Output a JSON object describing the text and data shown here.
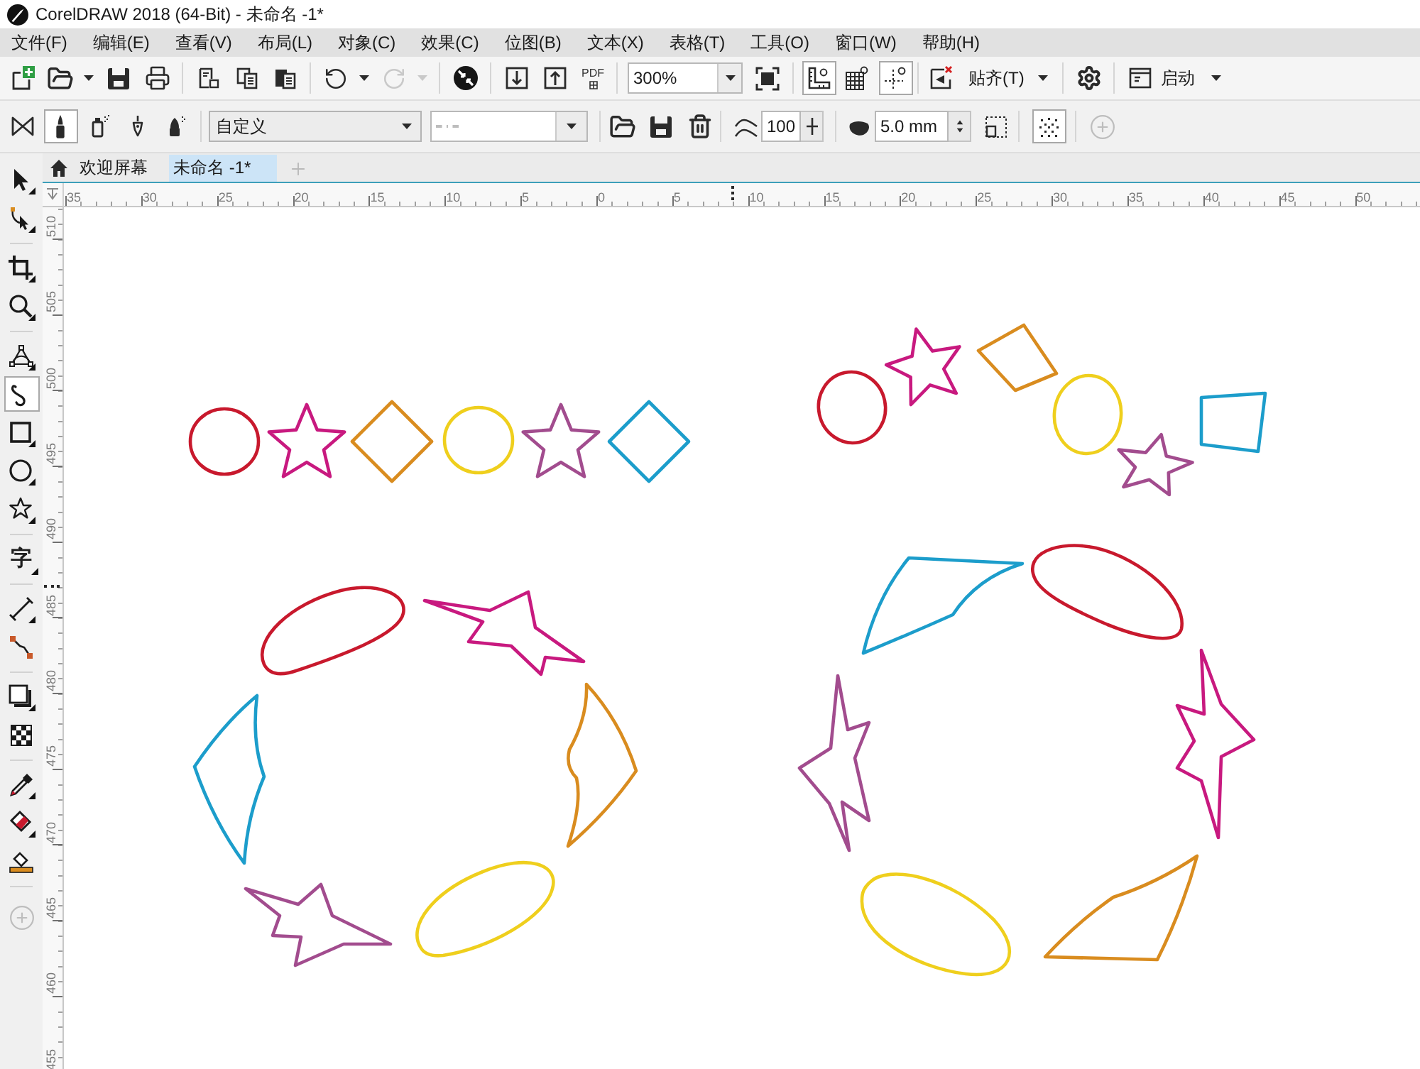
{
  "window": {
    "title": "CorelDRAW 2018 (64-Bit) - 未命名 -1*"
  },
  "menu": [
    "文件(F)",
    "编辑(E)",
    "查看(V)",
    "布局(L)",
    "对象(C)",
    "效果(C)",
    "位图(B)",
    "文本(X)",
    "表格(T)",
    "工具(O)",
    "窗口(W)",
    "帮助(H)"
  ],
  "standard_toolbar": {
    "redo": {
      "disabled": true
    },
    "pdf_label": "PDF",
    "zoom": "300%",
    "view_toggles": [
      {
        "on": true
      },
      {
        "on": false
      },
      {
        "on": true
      }
    ],
    "snap_label": "贴齐(T)",
    "launcher_label": "启动"
  },
  "property_bar": {
    "modes": [
      {
        "selected": false
      },
      {
        "selected": true
      },
      {
        "selected": false
      },
      {
        "selected": false
      },
      {
        "selected": false
      }
    ],
    "preset": "自定义",
    "smoothing": "100",
    "width": "5.0 mm",
    "options_toggle": {
      "on": true
    },
    "add_button": {
      "disabled": true
    }
  },
  "toolbox": {
    "groups": [
      [
        {
          "kind": "tool",
          "selected": false
        },
        {
          "kind": "tool",
          "selected": false
        }
      ],
      [
        {
          "kind": "tool",
          "selected": false
        },
        {
          "kind": "tool",
          "selected": false
        }
      ],
      [
        {
          "kind": "tool",
          "selected": false
        },
        {
          "kind": "tool",
          "selected": true
        },
        {
          "kind": "tool",
          "selected": false
        },
        {
          "kind": "tool",
          "selected": false
        },
        {
          "kind": "tool",
          "selected": false
        }
      ],
      [
        {
          "kind": "glyph",
          "label": "字",
          "selected": false
        }
      ],
      [
        {
          "kind": "tool",
          "selected": false
        },
        {
          "kind": "tool",
          "selected": false
        }
      ],
      [
        {
          "kind": "tool",
          "selected": false
        },
        {
          "kind": "tool",
          "selected": false
        }
      ],
      [
        {
          "kind": "tool",
          "selected": false
        },
        {
          "kind": "tool",
          "selected": false
        },
        {
          "kind": "tool",
          "selected": false
        }
      ],
      [
        {
          "kind": "add"
        }
      ]
    ]
  },
  "tabs": [
    {
      "kind": "home",
      "label": "欢迎屏幕",
      "selected": false
    },
    {
      "kind": "document",
      "label": "未命名 -1*",
      "selected": true
    }
  ],
  "horizontal_ruler": [
    "35",
    "30",
    "25",
    "20",
    "15",
    "10",
    "5",
    "0",
    "5",
    "10",
    "15",
    "20",
    "25",
    "30",
    "35",
    "40",
    "45",
    "50"
  ],
  "vertical_ruler": [
    "510",
    "505",
    "500",
    "495",
    "490",
    "485",
    "480",
    "475",
    "470",
    "465",
    "460",
    "455"
  ],
  "canvas": {
    "groups": [
      {
        "shapes": [
          {
            "kind": "ellipse",
            "color": "#c8192d"
          },
          {
            "kind": "star",
            "color": "#c8197f"
          },
          {
            "kind": "diamond",
            "color": "#d98c1f"
          },
          {
            "kind": "ellipse",
            "color": "#efcf1d"
          },
          {
            "kind": "star",
            "color": "#a24c8e"
          },
          {
            "kind": "diamond",
            "color": "#1c9dcb"
          }
        ]
      },
      {
        "shapes": [
          {
            "kind": "ellipse",
            "color": "#c8192d"
          },
          {
            "kind": "star",
            "color": "#c8197f"
          },
          {
            "kind": "diamond",
            "color": "#d98c1f"
          },
          {
            "kind": "ellipse",
            "color": "#efcf1d"
          },
          {
            "kind": "star",
            "color": "#a24c8e"
          },
          {
            "kind": "diamond",
            "color": "#1c9dcb"
          }
        ]
      },
      {
        "shapes": [
          {
            "kind": "ellipse",
            "color": "#c8192d"
          },
          {
            "kind": "star",
            "color": "#c8197f"
          },
          {
            "kind": "diamond",
            "color": "#d98c1f"
          },
          {
            "kind": "ellipse",
            "color": "#efcf1d"
          },
          {
            "kind": "star",
            "color": "#a24c8e"
          },
          {
            "kind": "diamond",
            "color": "#1c9dcb"
          }
        ]
      },
      {
        "shapes": [
          {
            "kind": "ellipse",
            "color": "#c8192d"
          },
          {
            "kind": "star",
            "color": "#c8197f"
          },
          {
            "kind": "diamond",
            "color": "#d98c1f"
          },
          {
            "kind": "ellipse",
            "color": "#efcf1d"
          },
          {
            "kind": "star",
            "color": "#a24c8e"
          },
          {
            "kind": "diamond",
            "color": "#1c9dcb"
          }
        ]
      }
    ]
  }
}
